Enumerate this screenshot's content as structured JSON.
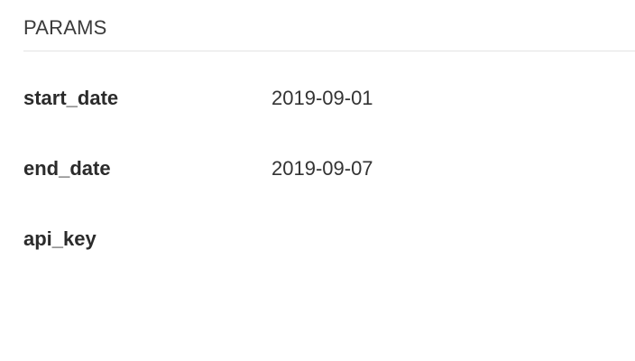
{
  "section": {
    "title": "PARAMS"
  },
  "params": [
    {
      "name": "start_date",
      "value": "2019-09-01"
    },
    {
      "name": "end_date",
      "value": "2019-09-07"
    },
    {
      "name": "api_key",
      "value": ""
    }
  ]
}
